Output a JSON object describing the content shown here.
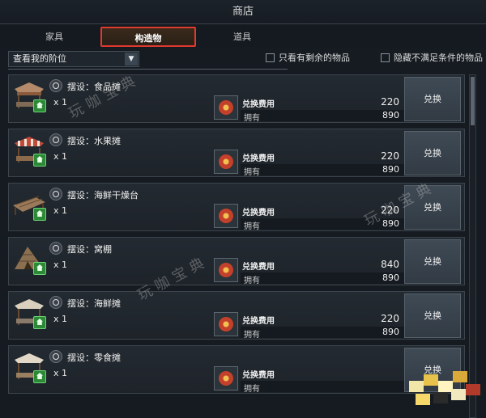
{
  "title": "商店",
  "tabs": [
    {
      "label": "家具"
    },
    {
      "label": "构造物"
    },
    {
      "label": "道具"
    }
  ],
  "filter": {
    "select_value": "查看我的阶位",
    "check1": "只看有剩余的物品",
    "check2": "隐藏不满足条件的物品"
  },
  "items": [
    {
      "name": "摆设：食品摊",
      "qty": "x 1",
      "cost_label": "兑换费用",
      "cost": "220",
      "own_label": "拥有",
      "own": "890",
      "button": "兑换"
    },
    {
      "name": "摆设：水果摊",
      "qty": "x 1",
      "cost_label": "兑换费用",
      "cost": "220",
      "own_label": "拥有",
      "own": "890",
      "button": "兑换"
    },
    {
      "name": "摆设：海鲜干燥台",
      "qty": "x 1",
      "cost_label": "兑换费用",
      "cost": "220",
      "own_label": "拥有",
      "own": "890",
      "button": "兑换"
    },
    {
      "name": "摆设：窝棚",
      "qty": "x 1",
      "cost_label": "兑换费用",
      "cost": "840",
      "own_label": "拥有",
      "own": "890",
      "button": "兑换"
    },
    {
      "name": "摆设：海鲜摊",
      "qty": "x 1",
      "cost_label": "兑换费用",
      "cost": "220",
      "own_label": "拥有",
      "own": "890",
      "button": "兑换"
    },
    {
      "name": "摆设：零食摊",
      "qty": "x 1",
      "cost_label": "兑换费用",
      "cost": "",
      "own_label": "拥有",
      "own": "",
      "button": "兑换"
    }
  ],
  "watermark": "玩咖宝典",
  "colors": {
    "tab_highlight": "#e0392e",
    "home_badge": "#2c8a36",
    "coin": "#c3412b"
  }
}
